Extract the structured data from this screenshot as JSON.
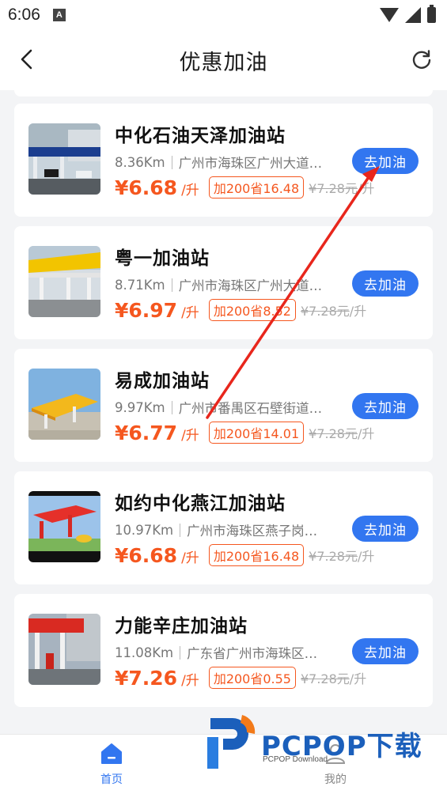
{
  "status_bar": {
    "time": "6:06",
    "notification_icon": "A"
  },
  "header": {
    "title": "优惠加油",
    "back_icon": "chevron-left-icon",
    "refresh_icon": "refresh-icon"
  },
  "stations": [
    {
      "name": "中化石油天泽加油站",
      "distance": "8.36Km",
      "address": "广州市海珠区广州大道…",
      "price": "¥6.68",
      "unit": "/升",
      "promo": "加200省16.48",
      "original_price": "¥7.28元",
      "original_unit": "/升",
      "button": "去加油"
    },
    {
      "name": "粤一加油站",
      "distance": "8.71Km",
      "address": "广州市海珠区广州大道…",
      "price": "¥6.97",
      "unit": "/升",
      "promo": "加200省8.52",
      "original_price": "¥7.28元",
      "original_unit": "/升",
      "button": "去加油"
    },
    {
      "name": "易成加油站",
      "distance": "9.97Km",
      "address": "广州市番禺区石壁街道…",
      "price": "¥6.77",
      "unit": "/升",
      "promo": "加200省14.01",
      "original_price": "¥7.28元",
      "original_unit": "/升",
      "button": "去加油"
    },
    {
      "name": "如约中化燕江加油站",
      "distance": "10.97Km",
      "address": "广州市海珠区燕子岗…",
      "price": "¥6.68",
      "unit": "/升",
      "promo": "加200省16.48",
      "original_price": "¥7.28元",
      "original_unit": "/升",
      "button": "去加油"
    },
    {
      "name": "力能辛庄加油站",
      "distance": "11.08Km",
      "address": "广东省广州市海珠区…",
      "price": "¥7.26",
      "unit": "/升",
      "promo": "加200省0.55",
      "original_price": "¥7.28元",
      "original_unit": "/升",
      "button": "去加油"
    }
  ],
  "tabbar": {
    "home_label": "首页",
    "home_icon": "home-icon",
    "mine_label": "我的",
    "mine_icon": "user-icon"
  },
  "watermark": {
    "text": "PCPOP下载",
    "sub": "PCPOP Download"
  },
  "colors": {
    "accent": "#3276f0",
    "price": "#f5571f",
    "annotation": "#e8261c"
  }
}
